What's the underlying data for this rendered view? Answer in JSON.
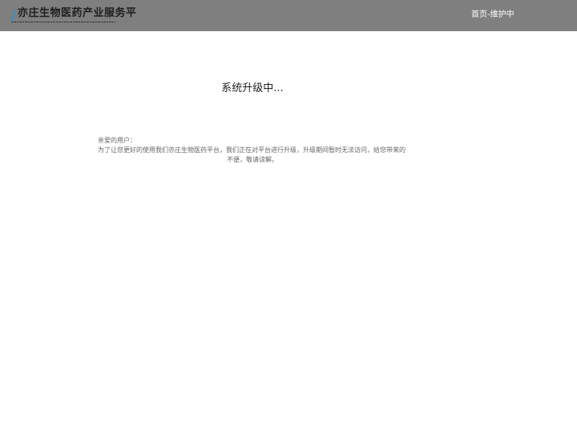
{
  "header": {
    "logo_text": "亦庄生物医药产业服务平",
    "breadcrumb_home": "首页",
    "breadcrumb_sep": "-",
    "breadcrumb_current": "维护中"
  },
  "main": {
    "title": "系统升级中...",
    "greeting": "亲爱的用户：",
    "message_line1": "为了让您更好的使用我们亦庄生物医药平台，我们正在对平台进行升级，升级期间暂时无法访问，给您带来的",
    "message_line2": "不便，敬请谅解。"
  },
  "colors": {
    "topbar_bg": "#7f7f7f",
    "logo_accent": "#3a8fc7",
    "text_primary": "#222222",
    "text_secondary": "#666666"
  }
}
